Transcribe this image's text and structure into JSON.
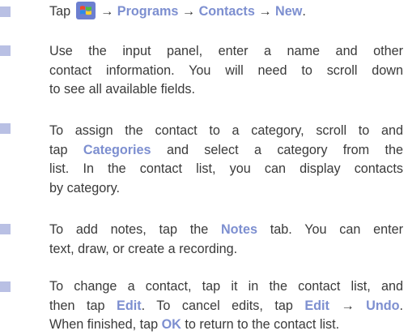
{
  "steps": [
    {
      "parts": {
        "tap": "Tap",
        "arrow1": "→",
        "programs": "Programs",
        "arrow2": "→",
        "contacts": "Contacts",
        "arrow3": "→",
        "new": "New",
        "end": "."
      },
      "icon": "windows-start-icon"
    },
    {
      "lines": [
        "Use the input panel, enter a name and other",
        "contact information. You will need to scroll down",
        "to see all available fields."
      ]
    },
    {
      "line1_pre": "To assign the contact to a category, scroll to and",
      "line2_pre": "tap",
      "categories": "Categories",
      "line2_post": "and select a category from the",
      "line3": "list. In the contact list, you can display contacts",
      "line4": "by category."
    },
    {
      "line1_pre": "To add notes, tap the",
      "notes": "Notes",
      "line1_post": "tab. You can enter",
      "line2": "text, draw, or create a recording."
    },
    {
      "line1": "To change a contact, tap it in the contact list, and",
      "line2_pre": "then tap",
      "edit1": "Edit",
      "line2_mid": ". To cancel edits, tap",
      "edit2": "Edit",
      "arrow": "→",
      "undo": "Undo",
      "line2_end": ".",
      "line3_pre": "When finished, tap",
      "ok": "OK",
      "line3_post": "to return to the contact list."
    }
  ],
  "colors": {
    "bullet": "#b9c0e4",
    "highlight": "#7d8fd0",
    "text": "#3a3a3a"
  }
}
